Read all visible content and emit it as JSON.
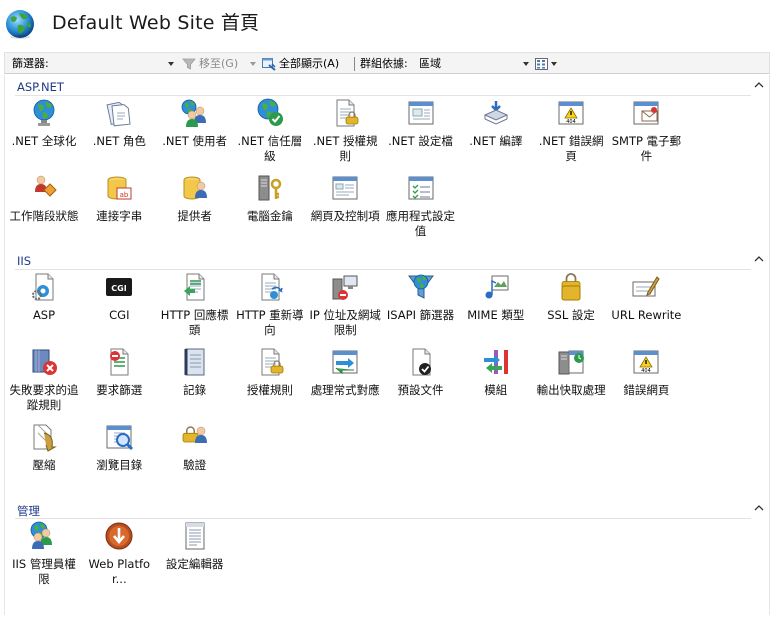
{
  "header": {
    "title": "Default Web Site 首頁"
  },
  "toolbar": {
    "filter_label": "篩選器:",
    "filter_value": "",
    "goto_label": "移至(G)",
    "show_all_label": "全部顯示(A)",
    "group_by_label": "群組依據:",
    "group_by_value": "區域"
  },
  "sections": [
    {
      "label": "ASP.NET",
      "items": [
        {
          "label": ".NET 全球化",
          "icon": "globe-icon"
        },
        {
          "label": ".NET 角色",
          "icon": "roles-icon"
        },
        {
          "label": ".NET 使用者",
          "icon": "users-icon"
        },
        {
          "label": ".NET 信任層級",
          "icon": "trust-levels-icon"
        },
        {
          "label": ".NET 授權規則",
          "icon": "authorization-rules-icon"
        },
        {
          "label": ".NET 設定檔",
          "icon": "profile-icon"
        },
        {
          "label": ".NET 編譯",
          "icon": "compilation-icon"
        },
        {
          "label": ".NET 錯誤網頁",
          "icon": "error-page-icon"
        },
        {
          "label": "SMTP 電子郵件",
          "icon": "smtp-email-icon"
        },
        {
          "label": "工作階段狀態",
          "icon": "session-state-icon"
        },
        {
          "label": "連接字串",
          "icon": "connection-strings-icon"
        },
        {
          "label": "提供者",
          "icon": "providers-icon"
        },
        {
          "label": "電腦金鑰",
          "icon": "machine-key-icon"
        },
        {
          "label": "網頁及控制項",
          "icon": "pages-controls-icon"
        },
        {
          "label": "應用程式設定值",
          "icon": "app-settings-icon"
        }
      ]
    },
    {
      "label": "IIS",
      "items": [
        {
          "label": "ASP",
          "icon": "asp-icon"
        },
        {
          "label": "CGI",
          "icon": "cgi-icon"
        },
        {
          "label": "HTTP 回應標頭",
          "icon": "http-headers-icon"
        },
        {
          "label": "HTTP 重新導向",
          "icon": "http-redirect-icon"
        },
        {
          "label": "IP 位址及網域限制",
          "icon": "ip-restrictions-icon"
        },
        {
          "label": "ISAPI 篩選器",
          "icon": "isapi-filters-icon"
        },
        {
          "label": "MIME 類型",
          "icon": "mime-types-icon"
        },
        {
          "label": "SSL 設定",
          "icon": "ssl-lock-icon"
        },
        {
          "label": "URL Rewrite",
          "icon": "url-rewrite-icon"
        },
        {
          "label": "失敗要求的追蹤規則",
          "icon": "failed-request-tracing-icon"
        },
        {
          "label": "要求篩選",
          "icon": "request-filtering-icon"
        },
        {
          "label": "記錄",
          "icon": "logging-icon"
        },
        {
          "label": "授權規則",
          "icon": "authorization-rules-icon"
        },
        {
          "label": "處理常式對應",
          "icon": "handler-mappings-icon"
        },
        {
          "label": "預設文件",
          "icon": "default-document-icon"
        },
        {
          "label": "模組",
          "icon": "modules-icon"
        },
        {
          "label": "輸出快取處理",
          "icon": "output-caching-icon"
        },
        {
          "label": "錯誤網頁",
          "icon": "error-page-icon"
        },
        {
          "label": "壓縮",
          "icon": "compression-icon"
        },
        {
          "label": "瀏覽目錄",
          "icon": "directory-browsing-icon"
        },
        {
          "label": "驗證",
          "icon": "authentication-icon"
        }
      ]
    },
    {
      "label": "管理",
      "items": [
        {
          "label": "IIS 管理員權限",
          "icon": "iis-manager-permissions-icon"
        },
        {
          "label": "Web Platfor...",
          "icon": "web-platform-icon"
        },
        {
          "label": "設定編輯器",
          "icon": "configuration-editor-icon"
        }
      ]
    }
  ],
  "colors": {
    "section_label": "#1e3a8a",
    "toolbar_bg": "#f4f4f4"
  }
}
